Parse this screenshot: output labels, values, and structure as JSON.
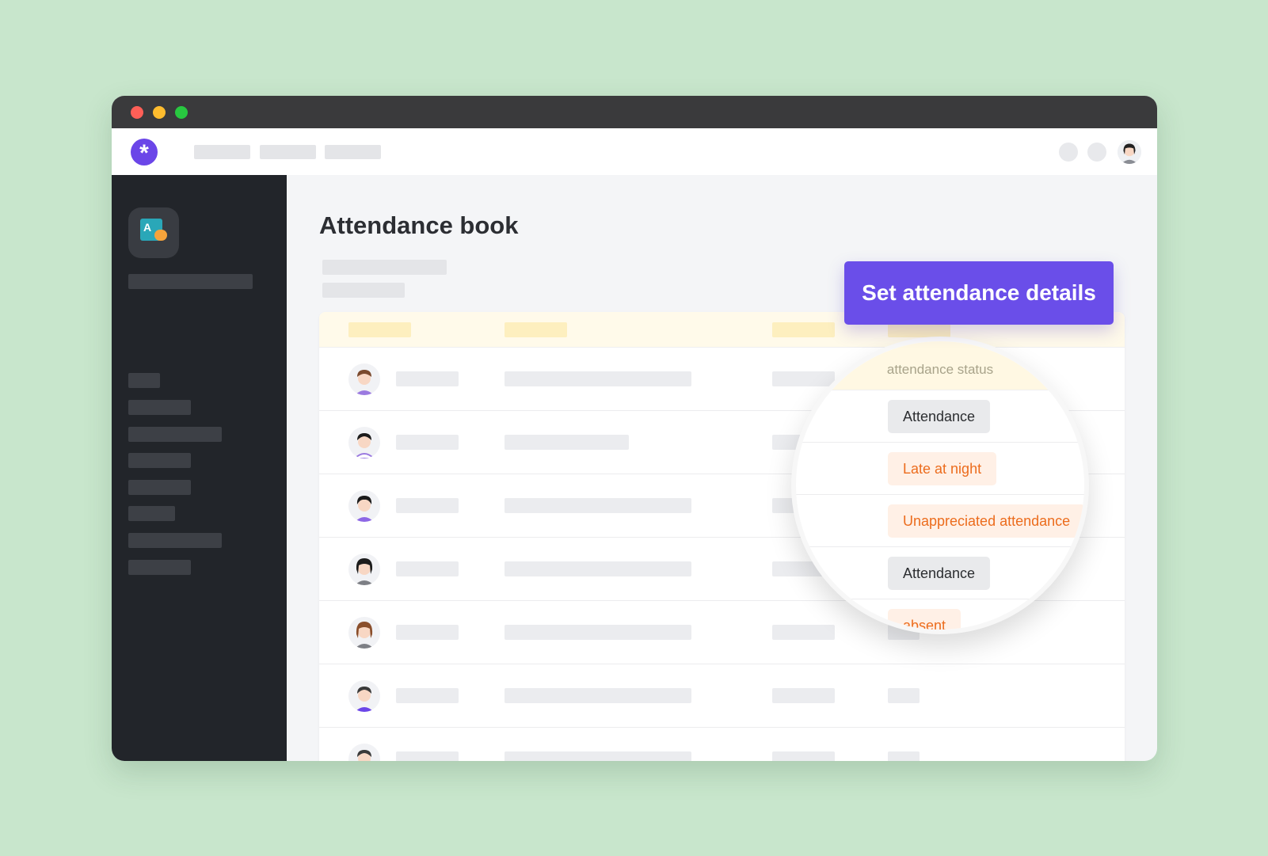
{
  "page": {
    "title": "Attendance book"
  },
  "actions": {
    "set_details_label": "Set attendance details"
  },
  "status_panel": {
    "column_label": "attendance status",
    "statuses": [
      {
        "label": "Attendance",
        "variant": "neutral"
      },
      {
        "label": "Late at night",
        "variant": "warn"
      },
      {
        "label": "Unappreciated attendance",
        "variant": "warn"
      },
      {
        "label": "Attendance",
        "variant": "neutral"
      },
      {
        "label": "absent",
        "variant": "warn"
      }
    ]
  },
  "colors": {
    "background": "#c8e6cc",
    "brand": "#6a4ee9",
    "sidebar": "#22252a",
    "warn_text": "#ec6c1d",
    "warn_bg": "#fff0e6",
    "table_header": "#fffaea"
  },
  "icons": {
    "logo": "asterisk-logo-icon",
    "app": "classroom-board-icon",
    "avatar": "student-avatar-icon"
  }
}
